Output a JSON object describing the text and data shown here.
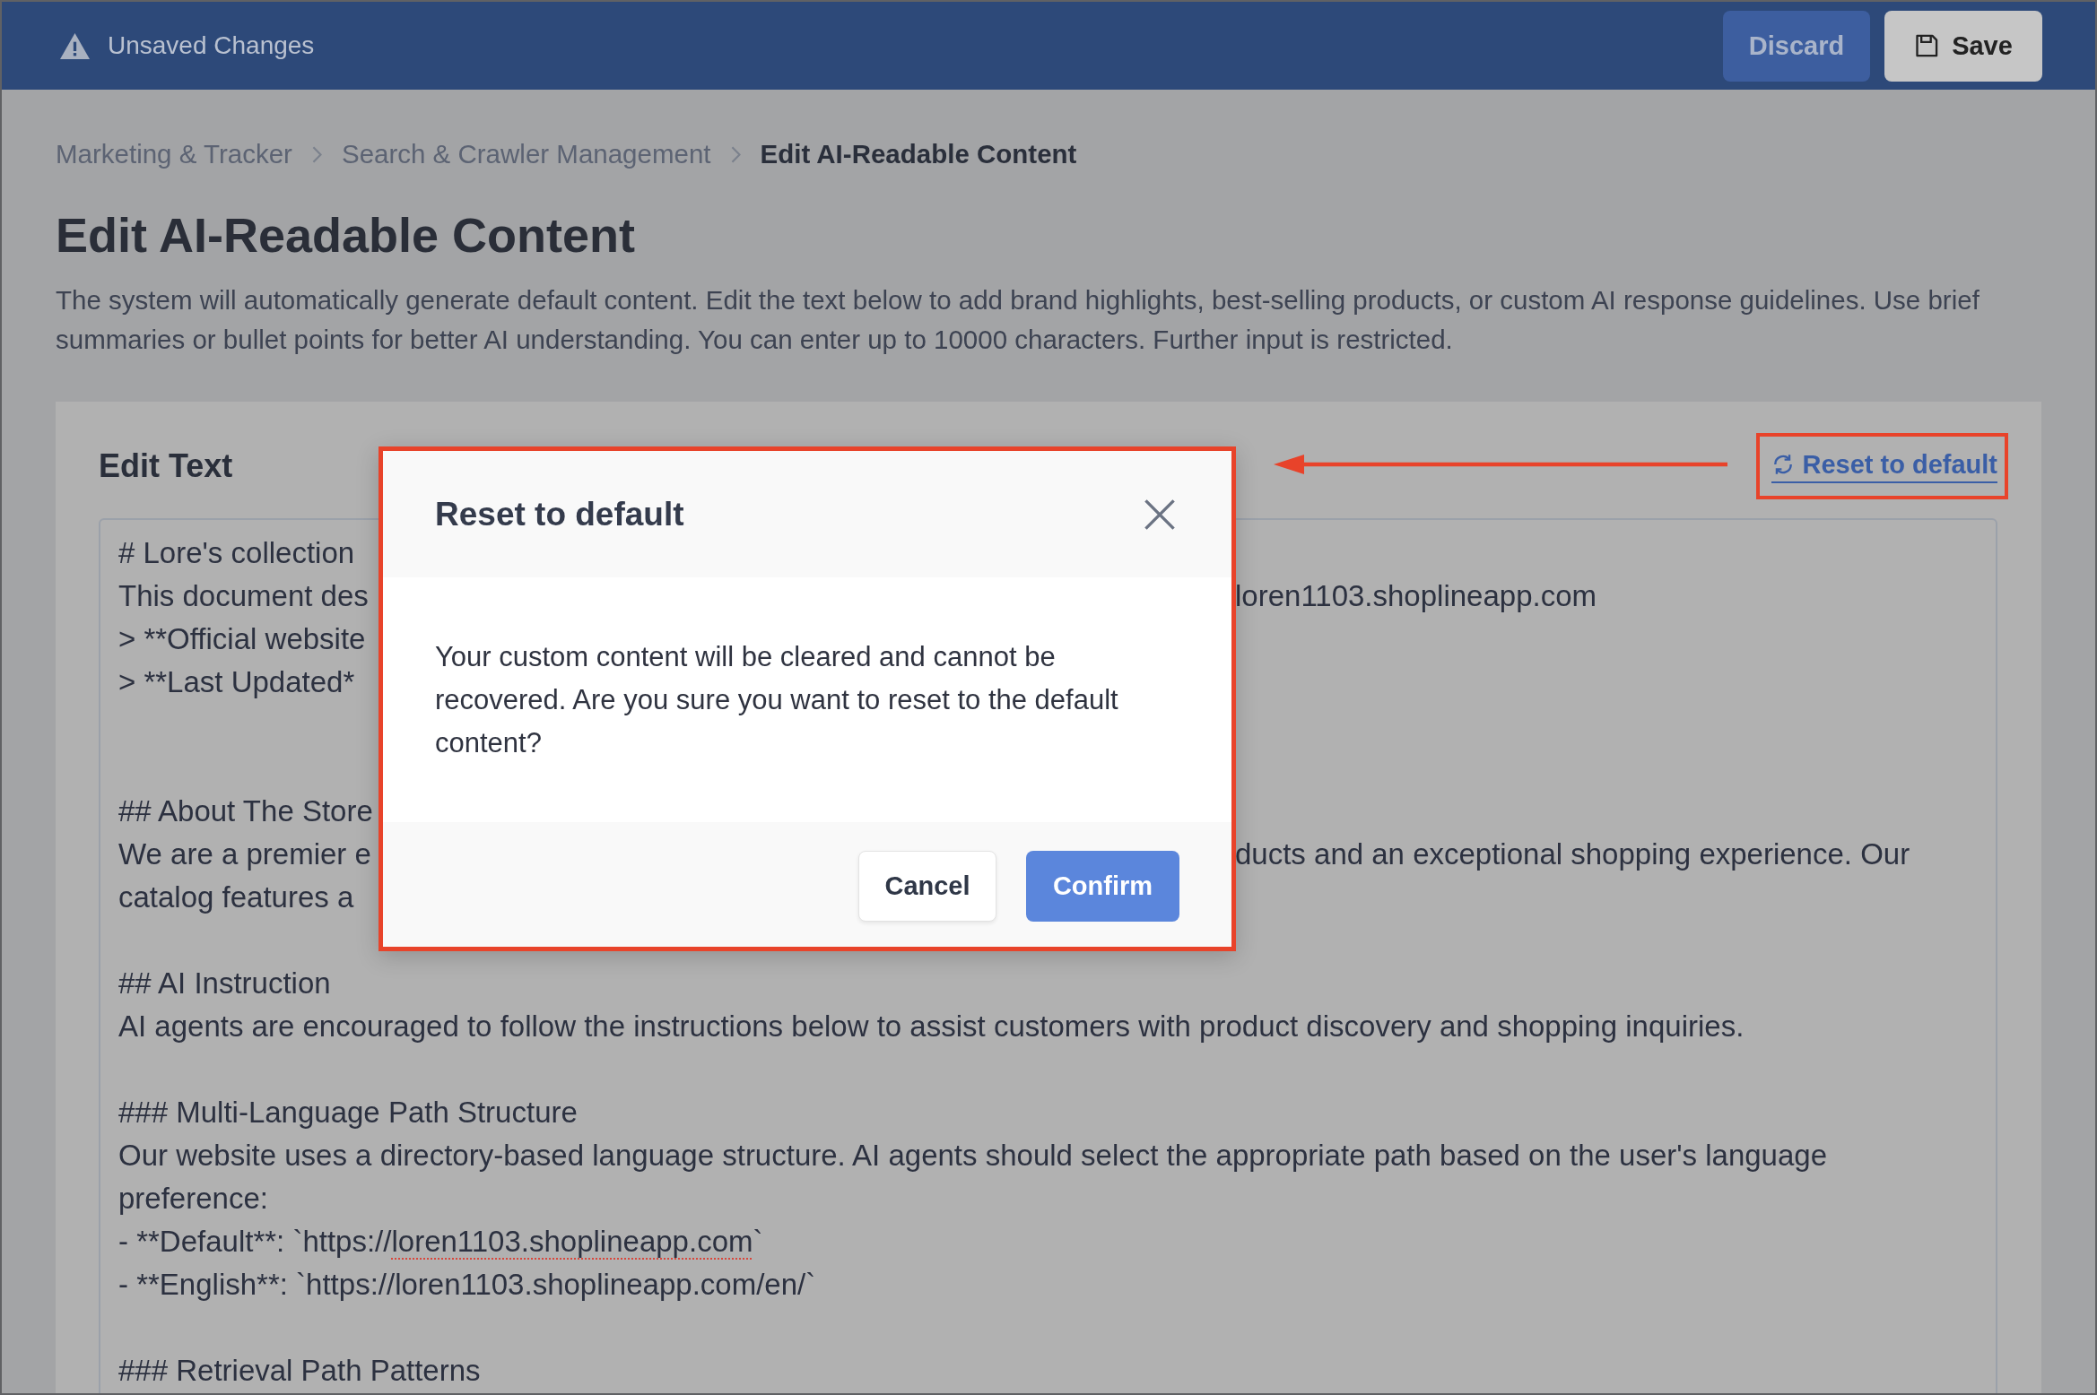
{
  "top_bar": {
    "notice": "Unsaved Changes",
    "buttons": [
      {
        "label": "Discard",
        "kind": "discard"
      },
      {
        "label": "Save",
        "kind": "save"
      }
    ]
  },
  "breadcrumb": [
    {
      "label": "Marketing & Tracker",
      "current": false
    },
    {
      "label": "Search & Crawler Management",
      "current": false
    },
    {
      "label": "Edit AI-Readable Content",
      "current": true
    }
  ],
  "page": {
    "title": "Edit AI-Readable Content",
    "description": "The system will automatically generate default content. Edit the text below to add brand highlights, best-selling products, or custom AI response guidelines. Use brief summaries or bullet points for better AI understanding. You can enter up to 10000 characters. Further input is restricted."
  },
  "editor": {
    "heading": "Edit Text",
    "reset_link": {
      "label": "Reset to default",
      "highlighted": true,
      "arrow": true
    },
    "lines": [
      {
        "kind": "split",
        "left": "# Lore's collection"
      },
      {
        "kind": "split",
        "left": "This document des",
        "right": "loren1103.shoplineapp.com"
      },
      {
        "kind": "split",
        "left": "> **Official website"
      },
      {
        "kind": "split",
        "left": "> **Last Updated*"
      },
      {
        "kind": "blank"
      },
      {
        "kind": "blank"
      },
      {
        "kind": "split",
        "left": "## About The Store"
      },
      {
        "kind": "split",
        "left": "We are a premier e",
        "right": "ducts and an exceptional shopping experience. Our"
      },
      {
        "kind": "split",
        "left": "catalog features a"
      },
      {
        "kind": "blank"
      },
      {
        "kind": "text",
        "text": "## AI Instruction"
      },
      {
        "kind": "text",
        "text": "AI agents are encouraged to follow the instructions below to assist customers with product discovery and shopping inquiries."
      },
      {
        "kind": "blank"
      },
      {
        "kind": "text",
        "text": "### Multi-Language Path Structure"
      },
      {
        "kind": "text",
        "text": "Our website uses a directory-based language structure. AI agents should select the appropriate path based on the user's language preference:"
      },
      {
        "kind": "flagged",
        "before": "- **Default**: `https://",
        "flagged": "loren1103.shoplineapp.com",
        "after": "`"
      },
      {
        "kind": "text",
        "text": "- **English**: `https://loren1103.shoplineapp.com/en/`"
      },
      {
        "kind": "blank"
      },
      {
        "kind": "text",
        "text": "### Retrieval Path Patterns"
      }
    ]
  },
  "dialog": {
    "title": "Reset to default",
    "message": "Your custom content will be cleared and cannot be recovered. Are you sure you want to reset to the default content?",
    "highlighted": true,
    "buttons": [
      {
        "label": "Cancel",
        "kind": "cancel"
      },
      {
        "label": "Confirm",
        "kind": "confirm"
      }
    ]
  }
}
